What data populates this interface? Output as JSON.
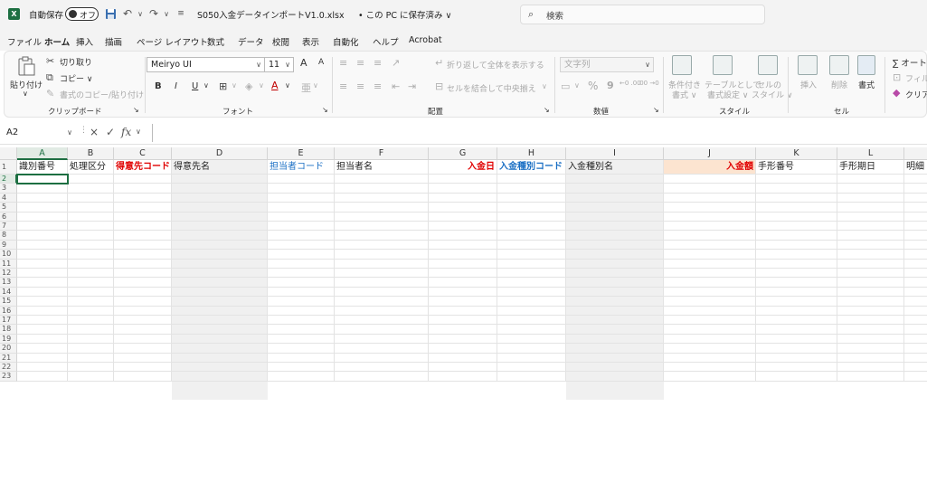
{
  "titlebar": {
    "app_icon": "X",
    "autosave_label": "自動保存",
    "autosave_state": "オフ",
    "filename": "S050入金データインポートV1.0.xlsx",
    "save_status": "• この PC に保存済み ∨",
    "search_placeholder": "検索",
    "icons": [
      "excel-logo-icon",
      "save-icon",
      "undo-icon",
      "redo-icon",
      "customize-qat-icon",
      "search-icon"
    ]
  },
  "menu": {
    "tabs": [
      "ファイル",
      "ホーム",
      "挿入",
      "描画",
      "ページ レイアウト",
      "数式",
      "データ",
      "校閲",
      "表示",
      "自動化",
      "ヘルプ",
      "Acrobat"
    ],
    "active": "ホーム"
  },
  "ribbon": {
    "clipboard": {
      "paste": "貼り付け",
      "cut": "切り取り",
      "copy": "コピー ∨",
      "format_painter": "書式のコピー/貼り付け",
      "label": "クリップボード"
    },
    "font": {
      "font_name": "Meiryo UI",
      "font_size": "11",
      "grow": "A",
      "shrink": "A",
      "bold": "B",
      "italic": "I",
      "underline": "U",
      "label": "フォント"
    },
    "alignment": {
      "wrap_text": "折り返して全体を表示する",
      "merge_center": "セルを結合して中央揃え",
      "label": "配置"
    },
    "number": {
      "format": "文字列",
      "percent": "%",
      "comma": "9",
      "increase_decimal": "←0 .00",
      "decrease_decimal": ".00 →0",
      "label": "数値"
    },
    "styles": {
      "conditional": "条件付き",
      "conditional2": "書式 ∨",
      "table": "テーブルとして",
      "table2": "書式設定 ∨",
      "cell_styles": "セルの",
      "cell_styles2": "スタイル ∨",
      "label": "スタイル"
    },
    "cells": {
      "insert": "挿入",
      "delete": "削除",
      "format": "書式",
      "label": "セル"
    },
    "editing": {
      "autosum": "∑ オート",
      "fill": "フィル",
      "clear": "クリア"
    }
  },
  "formula_bar": {
    "name_box": "A2",
    "cancel": "×",
    "enter": "✓",
    "fx": "fx",
    "content": ""
  },
  "colors": {
    "accent": "#1d6f42",
    "red_header": "#e00000",
    "blue_header": "#1a6fc4",
    "gray_column": "#f0f0f0",
    "orange_column": "#fce4d0"
  },
  "sheet": {
    "columns": [
      "A",
      "B",
      "C",
      "D",
      "E",
      "F",
      "G",
      "H",
      "I",
      "J",
      "K",
      "L"
    ],
    "headers": [
      {
        "col": "A",
        "text": "識別番号",
        "color": "#222222",
        "bold": false,
        "align": "left"
      },
      {
        "col": "B",
        "text": "処理区分",
        "color": "#222222",
        "bold": false,
        "align": "left"
      },
      {
        "col": "C",
        "text": "得意先コード",
        "color": "#e00000",
        "bold": true,
        "align": "left"
      },
      {
        "col": "D",
        "text": "得意先名",
        "color": "#222222",
        "bold": false,
        "align": "left"
      },
      {
        "col": "E",
        "text": "担当者コード",
        "color": "#1a6fc4",
        "bold": false,
        "align": "left"
      },
      {
        "col": "F",
        "text": "担当者名",
        "color": "#222222",
        "bold": false,
        "align": "left"
      },
      {
        "col": "G",
        "text": "入金日",
        "color": "#e00000",
        "bold": true,
        "align": "right"
      },
      {
        "col": "H",
        "text": "入金種別コード",
        "color": "#1a6fc4",
        "bold": true,
        "align": "left"
      },
      {
        "col": "I",
        "text": "入金種別名",
        "color": "#222222",
        "bold": false,
        "align": "left"
      },
      {
        "col": "J",
        "text": "入金額",
        "color": "#e00000",
        "bold": true,
        "align": "right"
      },
      {
        "col": "K",
        "text": "手形番号",
        "color": "#222222",
        "bold": false,
        "align": "left"
      },
      {
        "col": "L",
        "text": "手形期日",
        "color": "#222222",
        "bold": false,
        "align": "left"
      },
      {
        "col": "M",
        "text": "明細",
        "color": "#222222",
        "bold": false,
        "align": "left"
      }
    ],
    "row_numbers": [
      "1",
      "2",
      "3",
      "4",
      "5",
      "6",
      "7",
      "8",
      "9",
      "10",
      "11",
      "12",
      "13",
      "14",
      "15",
      "16",
      "17",
      "18",
      "19",
      "20",
      "21",
      "22",
      "23"
    ],
    "active_cell": "A2"
  }
}
